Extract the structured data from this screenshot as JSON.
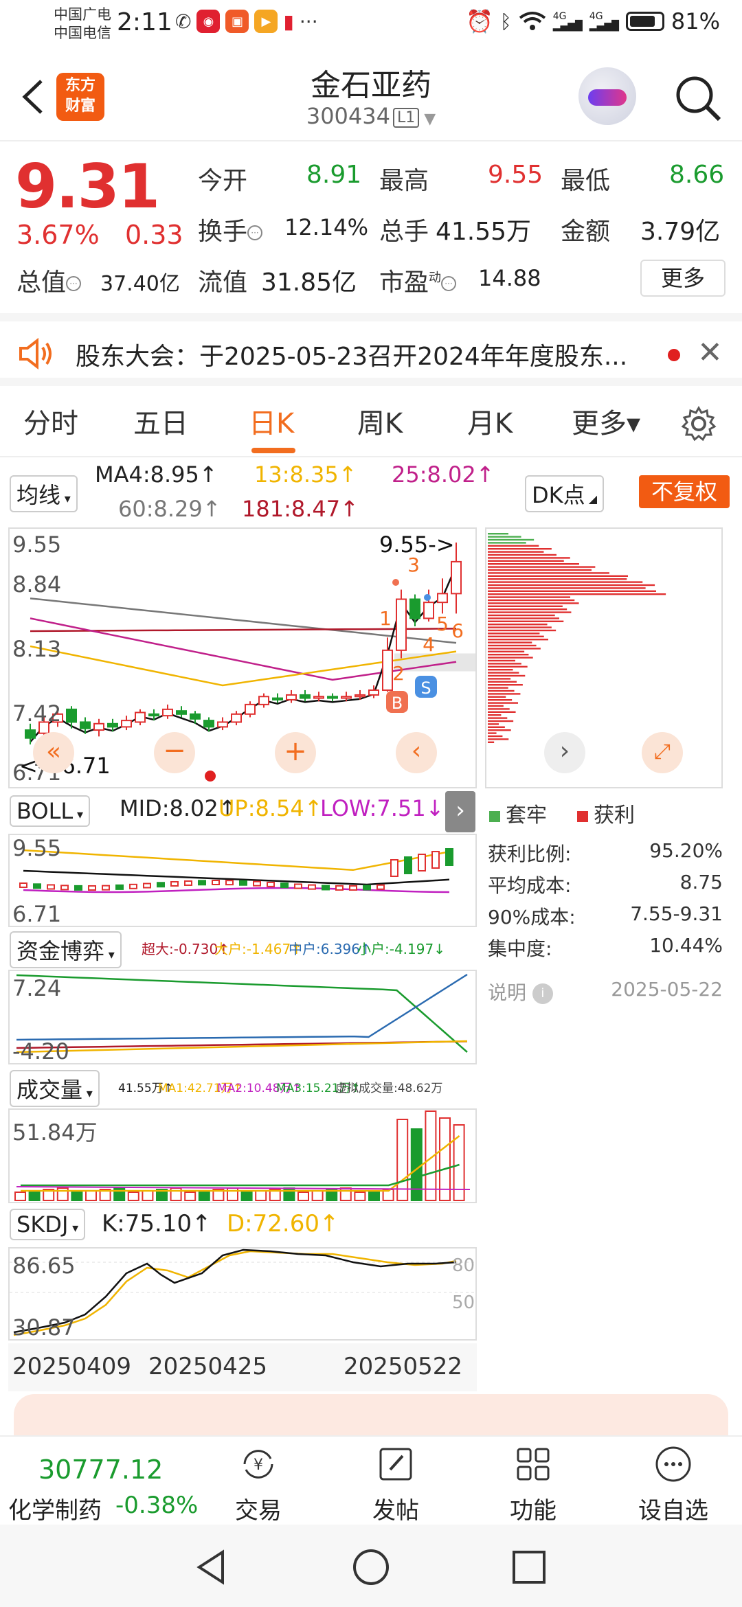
{
  "status": {
    "carrier1": "中国广电",
    "carrier2": "中国电信",
    "time": "2:11",
    "battery": "81%",
    "net1": "4G",
    "net2": "4G"
  },
  "header": {
    "logo_line1": "东方",
    "logo_line2": "财富",
    "stock_name": "金石亚药",
    "stock_code": "300434",
    "code_tag": "L1"
  },
  "quote": {
    "price": "9.31",
    "pct": "3.67%",
    "change": "0.33",
    "open_label": "今开",
    "open": "8.91",
    "high_label": "最高",
    "high": "9.55",
    "low_label": "最低",
    "low": "8.66",
    "turnover_label": "换手",
    "turnover": "12.14%",
    "volume_label": "总手",
    "volume": "41.55万",
    "amount_label": "金额",
    "amount": "3.79亿",
    "mcap_label": "总值",
    "mcap": "37.40亿",
    "float_label": "流值",
    "float": "31.85亿",
    "pe_label": "市盈",
    "pe_sup": "动",
    "pe": "14.88",
    "more_label": "更多"
  },
  "notice": {
    "text": "股东大会：于2025-05-23召开2024年年度股东..."
  },
  "tabs": [
    {
      "label": "分时"
    },
    {
      "label": "五日"
    },
    {
      "label": "日K"
    },
    {
      "label": "周K"
    },
    {
      "label": "月K"
    },
    {
      "label": "更多▾"
    }
  ],
  "ma": {
    "selector": "均线",
    "ma4": "MA4:8.95↑",
    "ma13": "13:8.35↑",
    "ma25": "25:8.02↑",
    "ma60": "60:8.29↑",
    "ma181": "181:8.47↑",
    "dk": "DK点",
    "fq": "不复权"
  },
  "kline": {
    "y_top": "9.55",
    "y_2": "8.84",
    "y_3": "8.13",
    "y_4": "7.42",
    "y_bottom": "6.71",
    "max_label": "9.55->",
    "min_label": "<---6.71",
    "markers": [
      "1",
      "2",
      "3",
      "4",
      "5",
      "6",
      "B",
      "S"
    ]
  },
  "boll": {
    "selector": "BOLL",
    "mid": "MID:8.02↑",
    "up": "UP:8.54↑",
    "low": "LOW:7.51↓",
    "y_top": "9.55",
    "y_bottom": "6.71"
  },
  "fund": {
    "selector": "资金博弈",
    "super": "超大:-0.730↑",
    "big": "大户:-1.467↑",
    "mid": "中户:6.396↑",
    "small": "小户:-4.197↓",
    "y_top": "7.24",
    "y_bottom": "-4.20"
  },
  "volume": {
    "selector": "成交量",
    "vol": "41.55万↑",
    "ma1": "MA1:42.71万↑",
    "ma2": "MA2:10.48万↑",
    "ma3": "MA3:15.21万↑",
    "virtual": "虚拟成交量:48.62万",
    "y_top": "51.84万"
  },
  "skdj": {
    "selector": "SKDJ",
    "k": "K:75.10↑",
    "d": "D:72.60↑",
    "y_top": "86.65",
    "y_bottom": "30.87",
    "ref80": "80",
    "ref50": "50"
  },
  "dates": [
    "20250409",
    "20250425",
    "20250522"
  ],
  "chips": {
    "legend_trapped": "套牢",
    "legend_profit": "获利",
    "profit_ratio_label": "获利比例:",
    "profit_ratio": "95.20%",
    "avg_cost_label": "平均成本:",
    "avg_cost": "8.75",
    "cost90_label": "90%成本:",
    "cost90": "7.55-9.31",
    "concentration_label": "集中度:",
    "concentration": "10.44%",
    "note_label": "说明",
    "date": "2025-05-22"
  },
  "bottom": {
    "index_value": "30777.12",
    "index_name": "化学制药",
    "index_pct": "-0.38%",
    "nav": [
      {
        "label": "交易"
      },
      {
        "label": "发帖"
      },
      {
        "label": "功能"
      },
      {
        "label": "设自选"
      }
    ]
  },
  "colors": {
    "up": "#e03030",
    "down": "#1a9b2e",
    "accent": "#f26d1f",
    "ma4": "#111111",
    "ma13": "#f0b400",
    "ma25": "#c0208a",
    "ma60": "#777777",
    "ma181": "#b0182a"
  }
}
